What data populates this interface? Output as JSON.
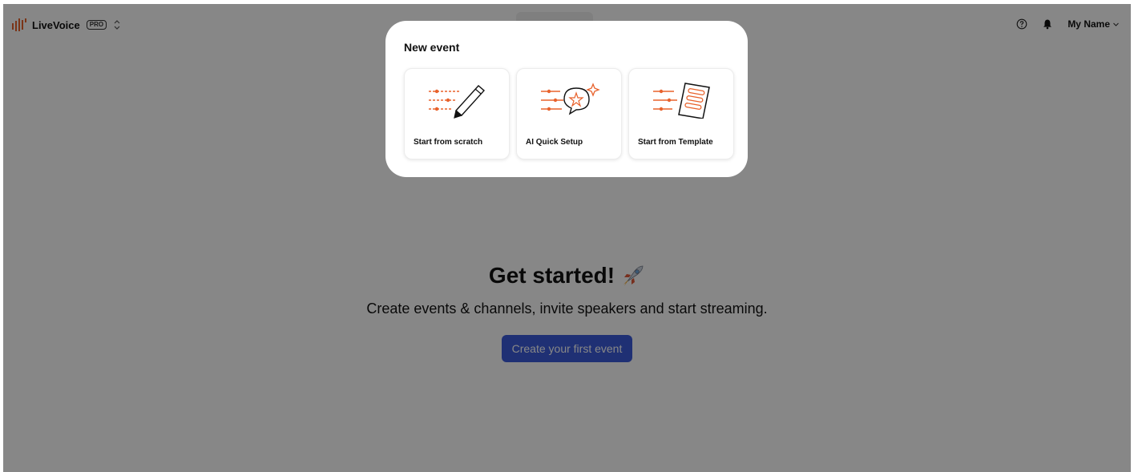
{
  "app": {
    "brand_name": "LiveVoice",
    "plan_badge": "PRO",
    "user_name": "My Name"
  },
  "hero": {
    "title": "Get started!",
    "subtitle": "Create events & channels, invite speakers and start streaming.",
    "cta_label": "Create your first event"
  },
  "modal": {
    "title": "New event",
    "options": [
      {
        "label": "Start from scratch",
        "icon": "pencil-list-illustration-icon"
      },
      {
        "label": "AI Quick Setup",
        "icon": "ai-speech-bubble-illustration-icon"
      },
      {
        "label": "Start from Template",
        "icon": "template-document-illustration-icon"
      }
    ]
  },
  "colors": {
    "accent": "#e8622c",
    "primary_button": "#3b5bdb",
    "overlay": "rgba(0,0,0,0.47)"
  }
}
